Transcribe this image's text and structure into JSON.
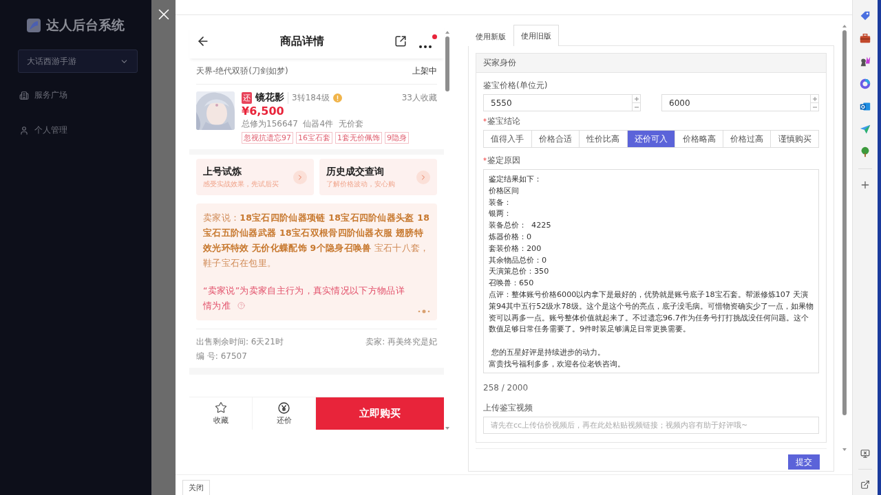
{
  "sidebar": {
    "title": "达人后台系统",
    "game_select": {
      "value": "大话西游手游"
    },
    "items": [
      {
        "label": "服务广场",
        "kind": "building"
      },
      {
        "label": "个人管理",
        "kind": "user"
      }
    ]
  },
  "preview": {
    "title": "商品详情",
    "server": "天界-绝代双骄(刀剑如梦)",
    "status": "上架中",
    "product": {
      "badge": "还",
      "name": "镜花影",
      "level": "3转184级",
      "favorites": "33人收藏",
      "price": "¥6,500",
      "summary": "总修为156647  仙器4件  无价套",
      "tags": [
        "忽视抗遗忘97",
        "16宝石套",
        "1套无价佩饰",
        "9隐身"
      ]
    },
    "actions": [
      {
        "title": "上号试炼",
        "subtitle": "感受实战效果，先试后买"
      },
      {
        "title": "历史成交查询",
        "subtitle": "了解价格波动，安心购"
      }
    ],
    "seller_note": "卖家说：**18宝石四阶仙器项链 18宝石四阶仙器头盔 18宝石五阶仙器武器 18宝石双根骨四阶仙器衣服 翅膀特效光环特效 无价化蝶配饰 9个隐身召唤兽** 宝石十八套，鞋子宝石在包里。",
    "disclaimer": "“卖家说”为卖家自主行为，真实情况以下方物品详情为准",
    "remaining": "出售剩余时间: 6天21时",
    "seller": "卖家: 再美终究是妃",
    "number": "编 号: 67507",
    "bottom_bar": {
      "favorite": "收藏",
      "bargain": "还价",
      "buy": "立即购买"
    }
  },
  "form": {
    "tabs": [
      {
        "label": "使用新版",
        "selected": false
      },
      {
        "label": "使用旧版",
        "selected": true
      }
    ],
    "section": "买家身份",
    "price_label": "鉴宝价格(单位元)",
    "price_min": "5550",
    "price_max": "6000",
    "conclusion_label": {
      "text": "鉴宝结论",
      "mark": "*"
    },
    "conclusions": [
      {
        "label": "值得入手",
        "selected": false
      },
      {
        "label": "价格合适",
        "selected": false
      },
      {
        "label": "性价比高",
        "selected": false
      },
      {
        "label": "还价可入",
        "selected": true
      },
      {
        "label": "价格略高",
        "selected": false
      },
      {
        "label": "价格过高",
        "selected": false
      },
      {
        "label": "谨慎购买",
        "selected": false
      }
    ],
    "reason_label": {
      "text": "鉴定原因",
      "mark": "*"
    },
    "reason_paragraphs": [
      [
        "鉴定结果如下：",
        "价格区间",
        "装备：",
        "银两：",
        "装备总价：  4225",
        "炼器价格：0",
        "套装价格：200",
        "其余物品总价：0",
        "天演策总价：350",
        "召唤兽：650",
        "点评：整体账号价格6000以内拿下是最好的，优势就是账号底子18宝石套。帮派修炼107 天演策94其中五行52级水78级。这个是这个号的亮点，底子没毛病。可惜物资确实少了一点，如果物资可以再多一点。账号整体价值就起来了。不过遗忘96.7作为任务号打打挑战没任何问题。这个数值足够日常任务需要了。9件时装足够满足日常更换需要。"
      ],
      [
        " 您的五星好评是持续进步的动力。",
        "富贵找号福利多多，欢迎各位老铁咨询。"
      ]
    ],
    "counter": "258 / 2000",
    "video_label": "上传鉴宝视频",
    "video_placeholder": "请先在cc上传估价视频后，再在此处粘贴视频链接；视频内容有助于好评哦~",
    "submit": "提交"
  },
  "footer": {
    "close": "关闭"
  }
}
